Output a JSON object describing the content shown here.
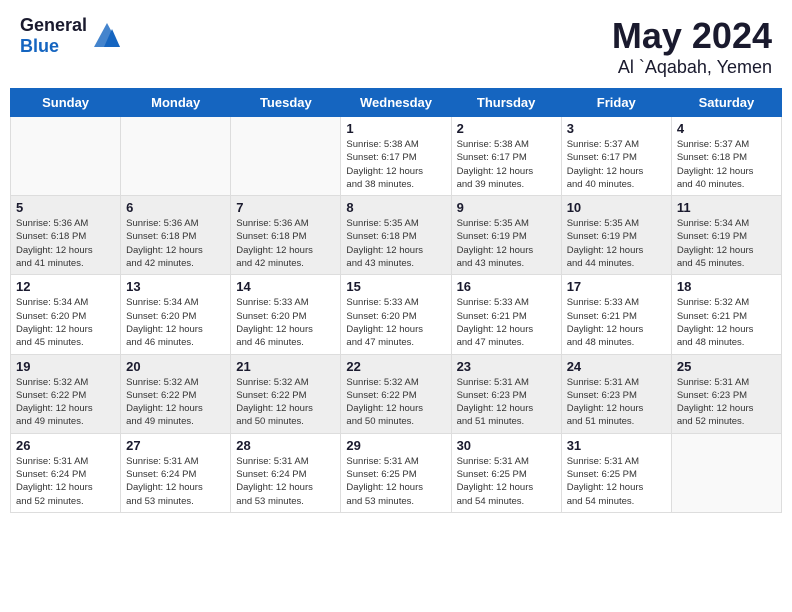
{
  "header": {
    "logo": {
      "general": "General",
      "blue": "Blue"
    },
    "title": "May 2024",
    "location": "Al `Aqabah, Yemen"
  },
  "weekdays": [
    "Sunday",
    "Monday",
    "Tuesday",
    "Wednesday",
    "Thursday",
    "Friday",
    "Saturday"
  ],
  "weeks": [
    [
      {
        "day": "",
        "info": ""
      },
      {
        "day": "",
        "info": ""
      },
      {
        "day": "",
        "info": ""
      },
      {
        "day": "1",
        "sunrise": "5:38 AM",
        "sunset": "6:17 PM",
        "daylight": "12 hours and 38 minutes."
      },
      {
        "day": "2",
        "sunrise": "5:38 AM",
        "sunset": "6:17 PM",
        "daylight": "12 hours and 39 minutes."
      },
      {
        "day": "3",
        "sunrise": "5:37 AM",
        "sunset": "6:17 PM",
        "daylight": "12 hours and 40 minutes."
      },
      {
        "day": "4",
        "sunrise": "5:37 AM",
        "sunset": "6:18 PM",
        "daylight": "12 hours and 40 minutes."
      }
    ],
    [
      {
        "day": "5",
        "sunrise": "5:36 AM",
        "sunset": "6:18 PM",
        "daylight": "12 hours and 41 minutes."
      },
      {
        "day": "6",
        "sunrise": "5:36 AM",
        "sunset": "6:18 PM",
        "daylight": "12 hours and 42 minutes."
      },
      {
        "day": "7",
        "sunrise": "5:36 AM",
        "sunset": "6:18 PM",
        "daylight": "12 hours and 42 minutes."
      },
      {
        "day": "8",
        "sunrise": "5:35 AM",
        "sunset": "6:18 PM",
        "daylight": "12 hours and 43 minutes."
      },
      {
        "day": "9",
        "sunrise": "5:35 AM",
        "sunset": "6:19 PM",
        "daylight": "12 hours and 43 minutes."
      },
      {
        "day": "10",
        "sunrise": "5:35 AM",
        "sunset": "6:19 PM",
        "daylight": "12 hours and 44 minutes."
      },
      {
        "day": "11",
        "sunrise": "5:34 AM",
        "sunset": "6:19 PM",
        "daylight": "12 hours and 45 minutes."
      }
    ],
    [
      {
        "day": "12",
        "sunrise": "5:34 AM",
        "sunset": "6:20 PM",
        "daylight": "12 hours and 45 minutes."
      },
      {
        "day": "13",
        "sunrise": "5:34 AM",
        "sunset": "6:20 PM",
        "daylight": "12 hours and 46 minutes."
      },
      {
        "day": "14",
        "sunrise": "5:33 AM",
        "sunset": "6:20 PM",
        "daylight": "12 hours and 46 minutes."
      },
      {
        "day": "15",
        "sunrise": "5:33 AM",
        "sunset": "6:20 PM",
        "daylight": "12 hours and 47 minutes."
      },
      {
        "day": "16",
        "sunrise": "5:33 AM",
        "sunset": "6:21 PM",
        "daylight": "12 hours and 47 minutes."
      },
      {
        "day": "17",
        "sunrise": "5:33 AM",
        "sunset": "6:21 PM",
        "daylight": "12 hours and 48 minutes."
      },
      {
        "day": "18",
        "sunrise": "5:32 AM",
        "sunset": "6:21 PM",
        "daylight": "12 hours and 48 minutes."
      }
    ],
    [
      {
        "day": "19",
        "sunrise": "5:32 AM",
        "sunset": "6:22 PM",
        "daylight": "12 hours and 49 minutes."
      },
      {
        "day": "20",
        "sunrise": "5:32 AM",
        "sunset": "6:22 PM",
        "daylight": "12 hours and 49 minutes."
      },
      {
        "day": "21",
        "sunrise": "5:32 AM",
        "sunset": "6:22 PM",
        "daylight": "12 hours and 50 minutes."
      },
      {
        "day": "22",
        "sunrise": "5:32 AM",
        "sunset": "6:22 PM",
        "daylight": "12 hours and 50 minutes."
      },
      {
        "day": "23",
        "sunrise": "5:31 AM",
        "sunset": "6:23 PM",
        "daylight": "12 hours and 51 minutes."
      },
      {
        "day": "24",
        "sunrise": "5:31 AM",
        "sunset": "6:23 PM",
        "daylight": "12 hours and 51 minutes."
      },
      {
        "day": "25",
        "sunrise": "5:31 AM",
        "sunset": "6:23 PM",
        "daylight": "12 hours and 52 minutes."
      }
    ],
    [
      {
        "day": "26",
        "sunrise": "5:31 AM",
        "sunset": "6:24 PM",
        "daylight": "12 hours and 52 minutes."
      },
      {
        "day": "27",
        "sunrise": "5:31 AM",
        "sunset": "6:24 PM",
        "daylight": "12 hours and 53 minutes."
      },
      {
        "day": "28",
        "sunrise": "5:31 AM",
        "sunset": "6:24 PM",
        "daylight": "12 hours and 53 minutes."
      },
      {
        "day": "29",
        "sunrise": "5:31 AM",
        "sunset": "6:25 PM",
        "daylight": "12 hours and 53 minutes."
      },
      {
        "day": "30",
        "sunrise": "5:31 AM",
        "sunset": "6:25 PM",
        "daylight": "12 hours and 54 minutes."
      },
      {
        "day": "31",
        "sunrise": "5:31 AM",
        "sunset": "6:25 PM",
        "daylight": "12 hours and 54 minutes."
      },
      {
        "day": "",
        "info": ""
      }
    ]
  ],
  "labels": {
    "sunrise": "Sunrise:",
    "sunset": "Sunset:",
    "daylight": "Daylight hours"
  }
}
